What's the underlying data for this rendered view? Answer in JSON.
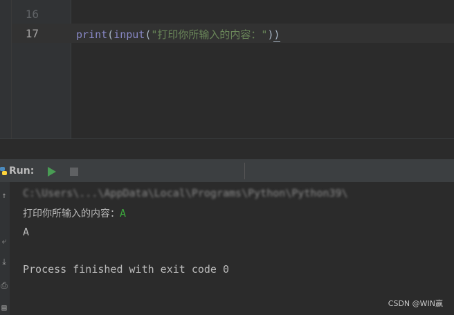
{
  "editor": {
    "lines": [
      {
        "number": "16",
        "code": ""
      },
      {
        "number": "17",
        "code_parts": {
          "fn1": "print",
          "p1": "(",
          "fn2": "input",
          "p2": "(",
          "str": "\"打印你所输入的内容：\"",
          "p3": ")",
          "p4": ")"
        }
      }
    ]
  },
  "run_panel": {
    "title": "Run:",
    "buttons": {
      "rerun": "play-icon",
      "stop": "stop-icon"
    }
  },
  "console": {
    "command_line_blurred": "C:\\Users\\...\\AppData\\Local\\Programs\\Python\\Python39\\",
    "prompt": "打印你所输入的内容：",
    "user_input": "A",
    "output": "A",
    "exit_message": "Process finished with exit code 0"
  },
  "watermark": "CSDN @WIN赢",
  "colors": {
    "builtin": "#8888c6",
    "string": "#6a8759",
    "user_input": "#3ca83c",
    "run_green": "#499c54"
  }
}
